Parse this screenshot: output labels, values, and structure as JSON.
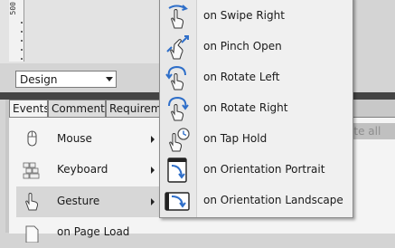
{
  "ruler": {
    "label": "500"
  },
  "view_select": {
    "value": "Design"
  },
  "tabs": [
    {
      "label": "Events"
    },
    {
      "label": "Comments"
    },
    {
      "label": "Requirements"
    }
  ],
  "toolbar": {
    "delete_all_label": "ete all"
  },
  "categories": [
    {
      "label": "Mouse",
      "icon": "mouse-icon"
    },
    {
      "label": "Keyboard",
      "icon": "keyboard-icon"
    },
    {
      "label": "Gesture",
      "icon": "hand-gesture-icon",
      "selected": true
    },
    {
      "label": "on Page Load",
      "icon": "page-icon"
    }
  ],
  "gesture_submenu": [
    {
      "label": "on Swipe Right",
      "icon": "swipe-right-icon"
    },
    {
      "label": "on Pinch Open",
      "icon": "pinch-open-icon"
    },
    {
      "label": "on Rotate Left",
      "icon": "rotate-left-icon"
    },
    {
      "label": "on Rotate Right",
      "icon": "rotate-right-icon"
    },
    {
      "label": "on Tap Hold",
      "icon": "tap-hold-icon"
    },
    {
      "label": "on Orientation Portrait",
      "icon": "orientation-portrait-icon"
    },
    {
      "label": "on Orientation Landscape",
      "icon": "orientation-landscape-icon"
    }
  ],
  "colors": {
    "accent_blue": "#2f6fc9",
    "menu_bg": "#f0f0f0",
    "dark_band": "#444444"
  }
}
